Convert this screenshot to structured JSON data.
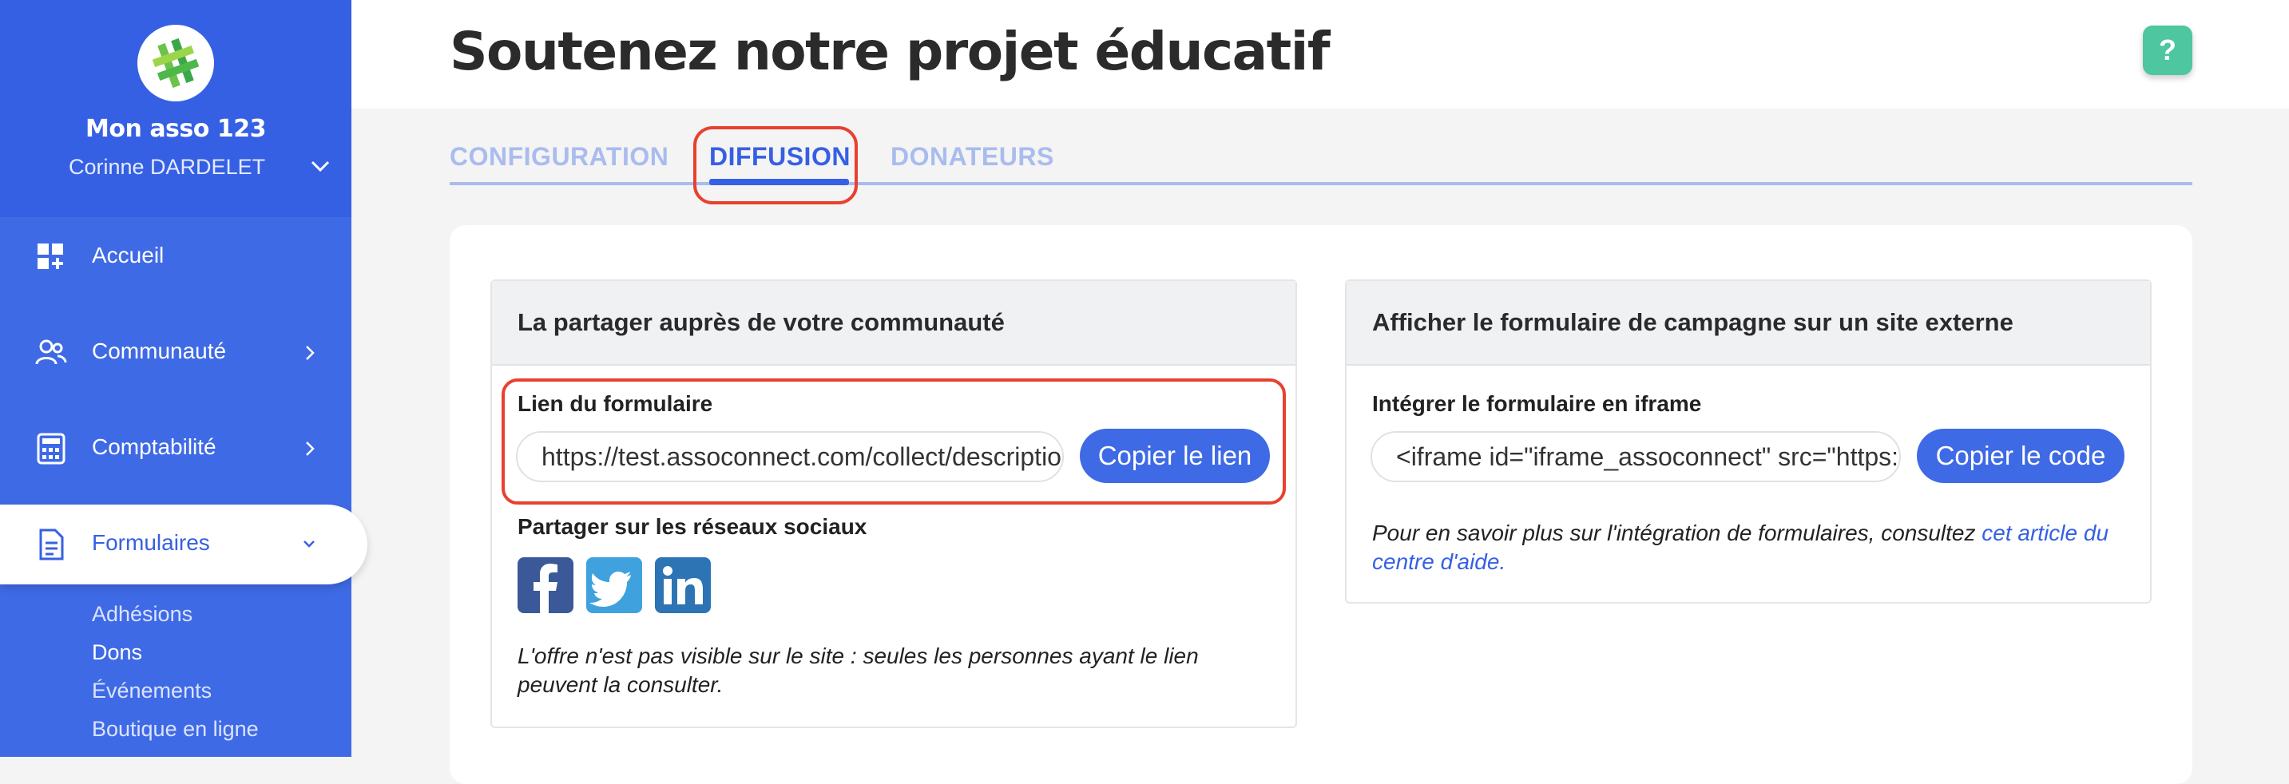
{
  "sidebar": {
    "org_name": "Mon asso 123",
    "user_name": "Corinne DARDELET",
    "items": [
      {
        "label": "Accueil",
        "icon": "dashboard-icon"
      },
      {
        "label": "Communauté",
        "icon": "people-icon"
      },
      {
        "label": "Comptabilité",
        "icon": "calculator-icon"
      },
      {
        "label": "Formulaires",
        "icon": "document-icon"
      }
    ],
    "sub_items": [
      "Adhésions",
      "Dons",
      "Événements",
      "Boutique en ligne"
    ]
  },
  "header": {
    "title": "Soutenez notre projet éducatif",
    "help_label": "?"
  },
  "tabs": [
    {
      "label": "CONFIGURATION"
    },
    {
      "label": "DIFFUSION"
    },
    {
      "label": "DONATEURS"
    }
  ],
  "share_card": {
    "title": "La partager auprès de votre communauté",
    "link_label": "Lien du formulaire",
    "link_value": "https://test.assoconnect.com/collect/description/",
    "copy_label": "Copier le lien",
    "social_label": "Partager sur les réseaux sociaux",
    "social": [
      "facebook-icon",
      "twitter-icon",
      "linkedin-icon"
    ],
    "note": "L'offre n'est pas visible sur le site : seules les personnes ayant le lien peuvent la consulter."
  },
  "embed_card": {
    "title": "Afficher le formulaire de campagne sur un site externe",
    "iframe_label": "Intégrer le formulaire en iframe",
    "iframe_value": "<iframe id=\"iframe_assoconnect\" src=\"https://",
    "copy_label": "Copier le code",
    "note_prefix": "Pour en savoir plus sur l'intégration de formulaires, consultez ",
    "note_link": "cet article du centre d'aide",
    "note_suffix": "."
  },
  "colors": {
    "sidebar": "#3f6ae6",
    "accent": "#3660e3",
    "highlight": "#e8412f",
    "help": "#4ec6a0"
  }
}
